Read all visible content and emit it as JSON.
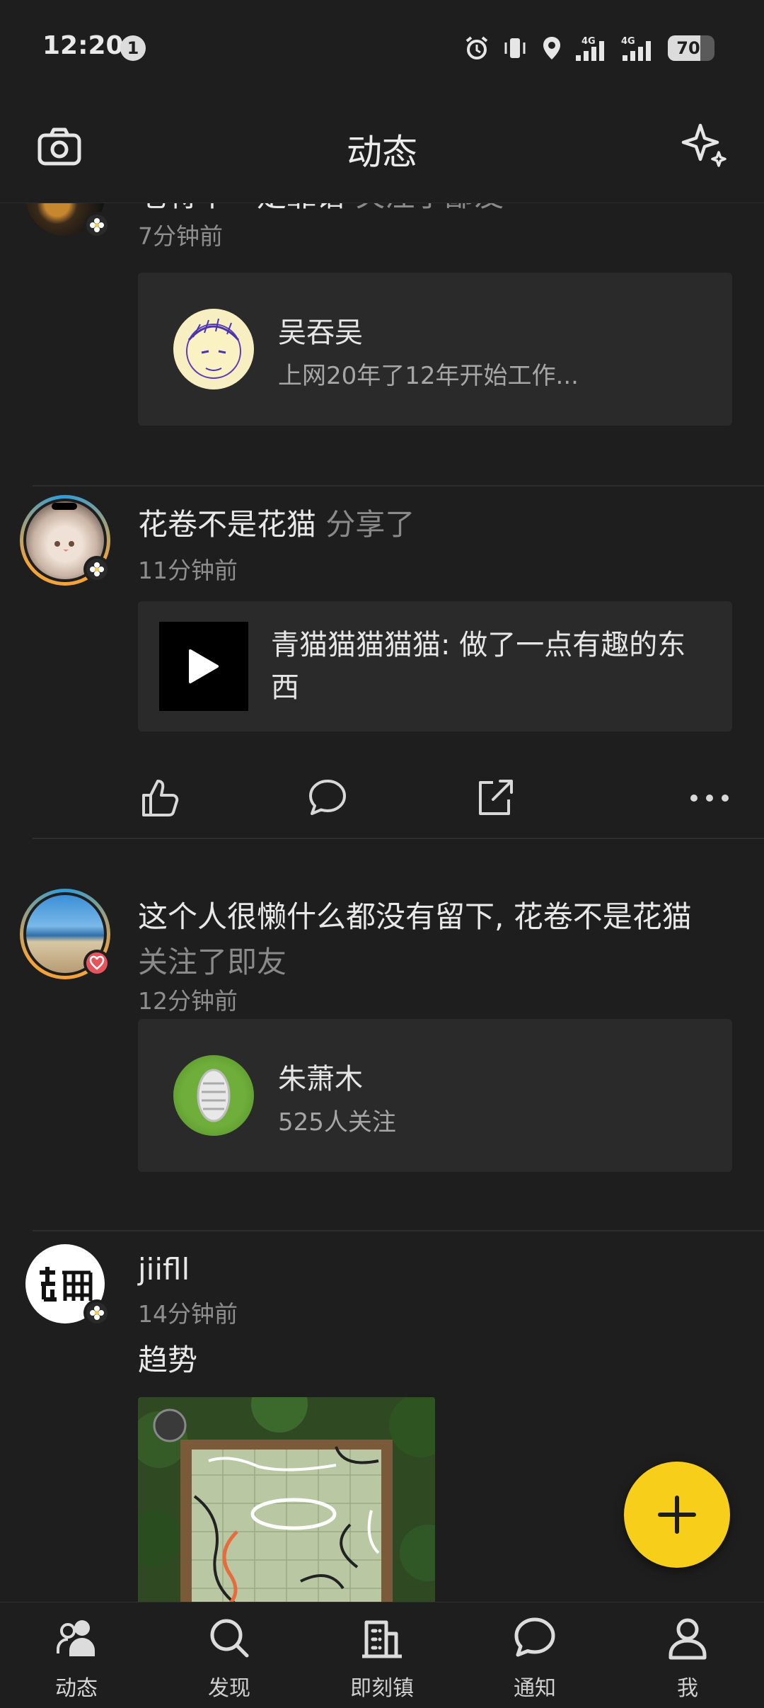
{
  "status_bar": {
    "time": "12:20",
    "notification_count": "1",
    "network_1": "4G",
    "network_2": "4G",
    "battery": "70",
    "battery_fraction": 0.7
  },
  "header": {
    "title": "动态",
    "left_icon": "camera-icon",
    "right_icon": "sparkle-icon"
  },
  "feed": [
    {
      "user": "老将不一定靠谱",
      "action": "关注了鄙友",
      "time": "7分钟前",
      "card": {
        "name": "吴吞吴",
        "subtitle": "上网20年了12年开始工作..."
      }
    },
    {
      "user": "花卷不是花猫",
      "action": "分享了",
      "time": "11分钟前",
      "shared_text": "青猫猫猫猫猫: 做了一点有趣的东西",
      "actions": [
        "like-icon",
        "comment-icon",
        "share-icon",
        "more-icon"
      ]
    },
    {
      "user": "这个人很懒什么都没有留下, 花卷不是花猫",
      "action": "关注了即友",
      "time": "12分钟前",
      "card": {
        "name": "朱萧木",
        "subtitle": "525人关注"
      }
    },
    {
      "user": "jiifll",
      "time": "14分钟前",
      "text": "趋势"
    }
  ],
  "fab": {
    "icon": "plus-icon"
  },
  "bottom_nav": [
    {
      "label": "动态",
      "icon": "users-icon",
      "active": true
    },
    {
      "label": "发现",
      "icon": "search-icon",
      "active": false
    },
    {
      "label": "即刻镇",
      "icon": "building-icon",
      "active": false
    },
    {
      "label": "通知",
      "icon": "chat-bubble-icon",
      "active": false
    },
    {
      "label": "我",
      "icon": "person-icon",
      "active": false
    }
  ],
  "colors": {
    "background": "#1e1e1e",
    "card": "#2a2a2a",
    "accent": "#f7cf1b",
    "muted": "#8a8a8a"
  }
}
